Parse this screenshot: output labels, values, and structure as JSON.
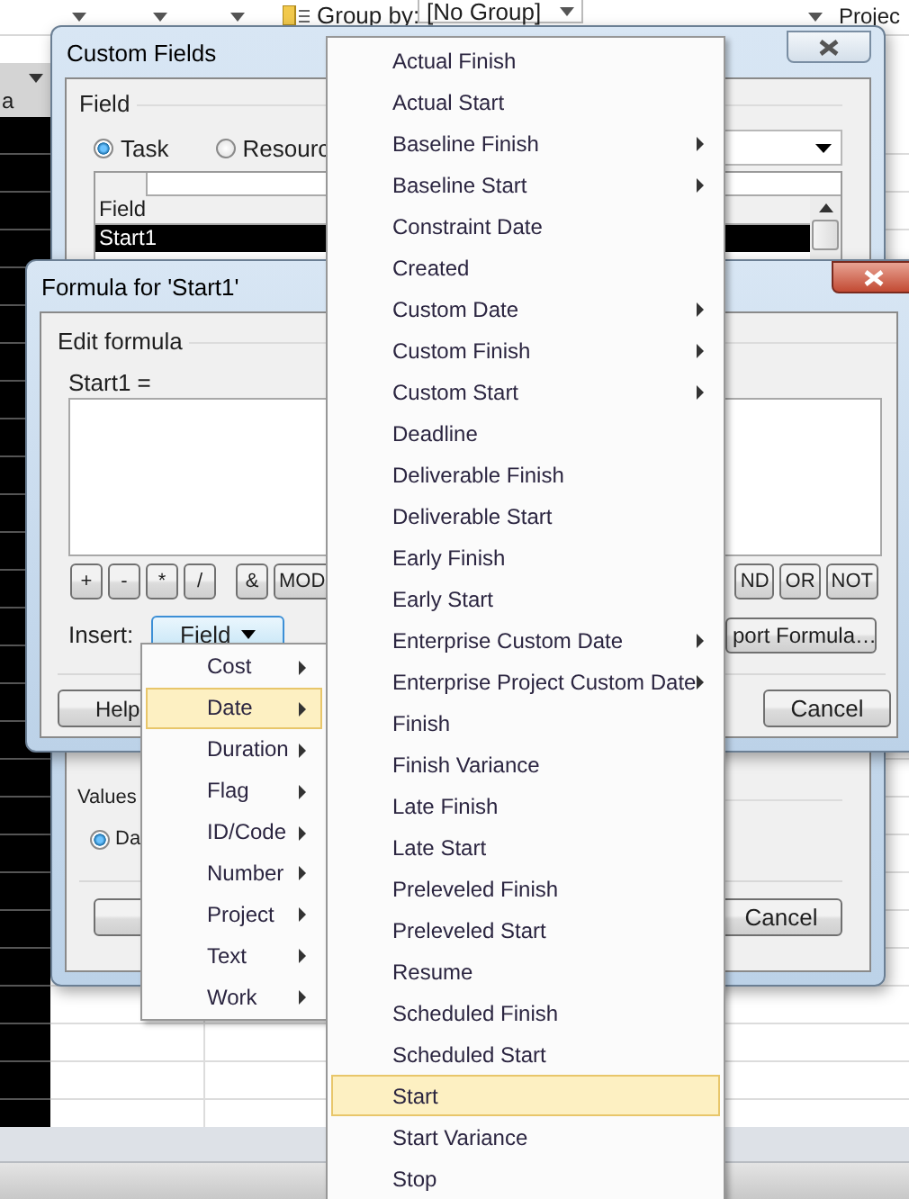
{
  "app": {
    "group_by_label": "Group by:",
    "group_by_value": "[No Group]",
    "project_label": "Projec",
    "grid_header": "a"
  },
  "custom_fields": {
    "title": "Custom Fields",
    "field_group": "Field",
    "radios": [
      {
        "label": "Task",
        "selected": true
      },
      {
        "label": "Resourc",
        "selected": false
      }
    ],
    "list_header": "Field",
    "rows": [
      {
        "name": "Start1",
        "selected": true
      }
    ],
    "values_group": "Values",
    "values_radios": [
      {
        "label": "Da",
        "selected": true
      }
    ],
    "cancel": "Cancel"
  },
  "formula": {
    "title": "Formula for 'Start1'",
    "group": "Edit formula",
    "formula_label": "Start1 =",
    "operators_left": [
      "+",
      "-",
      "*",
      "/",
      "&",
      "MOD"
    ],
    "operators_right": [
      "ND",
      "OR",
      "NOT"
    ],
    "insert_label": "Insert:",
    "field_button": "Field",
    "import_button": "port Formula…",
    "help": "Help",
    "cancel": "Cancel"
  },
  "field_menu": [
    {
      "label": "Cost",
      "submenu": true,
      "selected": false
    },
    {
      "label": "Date",
      "submenu": true,
      "selected": true
    },
    {
      "label": "Duration",
      "submenu": true,
      "selected": false
    },
    {
      "label": "Flag",
      "submenu": true,
      "selected": false
    },
    {
      "label": "ID/Code",
      "submenu": true,
      "selected": false
    },
    {
      "label": "Number",
      "submenu": true,
      "selected": false
    },
    {
      "label": "Project",
      "submenu": true,
      "selected": false
    },
    {
      "label": "Text",
      "submenu": true,
      "selected": false
    },
    {
      "label": "Work",
      "submenu": true,
      "selected": false
    }
  ],
  "date_menu": [
    {
      "label": "Actual Finish",
      "submenu": false,
      "selected": false
    },
    {
      "label": "Actual Start",
      "submenu": false,
      "selected": false
    },
    {
      "label": "Baseline Finish",
      "submenu": true,
      "selected": false
    },
    {
      "label": "Baseline Start",
      "submenu": true,
      "selected": false
    },
    {
      "label": "Constraint Date",
      "submenu": false,
      "selected": false
    },
    {
      "label": "Created",
      "submenu": false,
      "selected": false
    },
    {
      "label": "Custom Date",
      "submenu": true,
      "selected": false
    },
    {
      "label": "Custom Finish",
      "submenu": true,
      "selected": false
    },
    {
      "label": "Custom Start",
      "submenu": true,
      "selected": false
    },
    {
      "label": "Deadline",
      "submenu": false,
      "selected": false
    },
    {
      "label": "Deliverable Finish",
      "submenu": false,
      "selected": false
    },
    {
      "label": "Deliverable Start",
      "submenu": false,
      "selected": false
    },
    {
      "label": "Early Finish",
      "submenu": false,
      "selected": false
    },
    {
      "label": "Early Start",
      "submenu": false,
      "selected": false
    },
    {
      "label": "Enterprise Custom Date",
      "submenu": true,
      "selected": false
    },
    {
      "label": "Enterprise Project Custom Date",
      "submenu": true,
      "selected": false
    },
    {
      "label": "Finish",
      "submenu": false,
      "selected": false
    },
    {
      "label": "Finish Variance",
      "submenu": false,
      "selected": false
    },
    {
      "label": "Late Finish",
      "submenu": false,
      "selected": false
    },
    {
      "label": "Late Start",
      "submenu": false,
      "selected": false
    },
    {
      "label": "Preleveled Finish",
      "submenu": false,
      "selected": false
    },
    {
      "label": "Preleveled Start",
      "submenu": false,
      "selected": false
    },
    {
      "label": "Resume",
      "submenu": false,
      "selected": false
    },
    {
      "label": "Scheduled Finish",
      "submenu": false,
      "selected": false
    },
    {
      "label": "Scheduled Start",
      "submenu": false,
      "selected": false
    },
    {
      "label": "Start",
      "submenu": false,
      "selected": true
    },
    {
      "label": "Start Variance",
      "submenu": false,
      "selected": false
    },
    {
      "label": "Stop",
      "submenu": false,
      "selected": false
    }
  ]
}
